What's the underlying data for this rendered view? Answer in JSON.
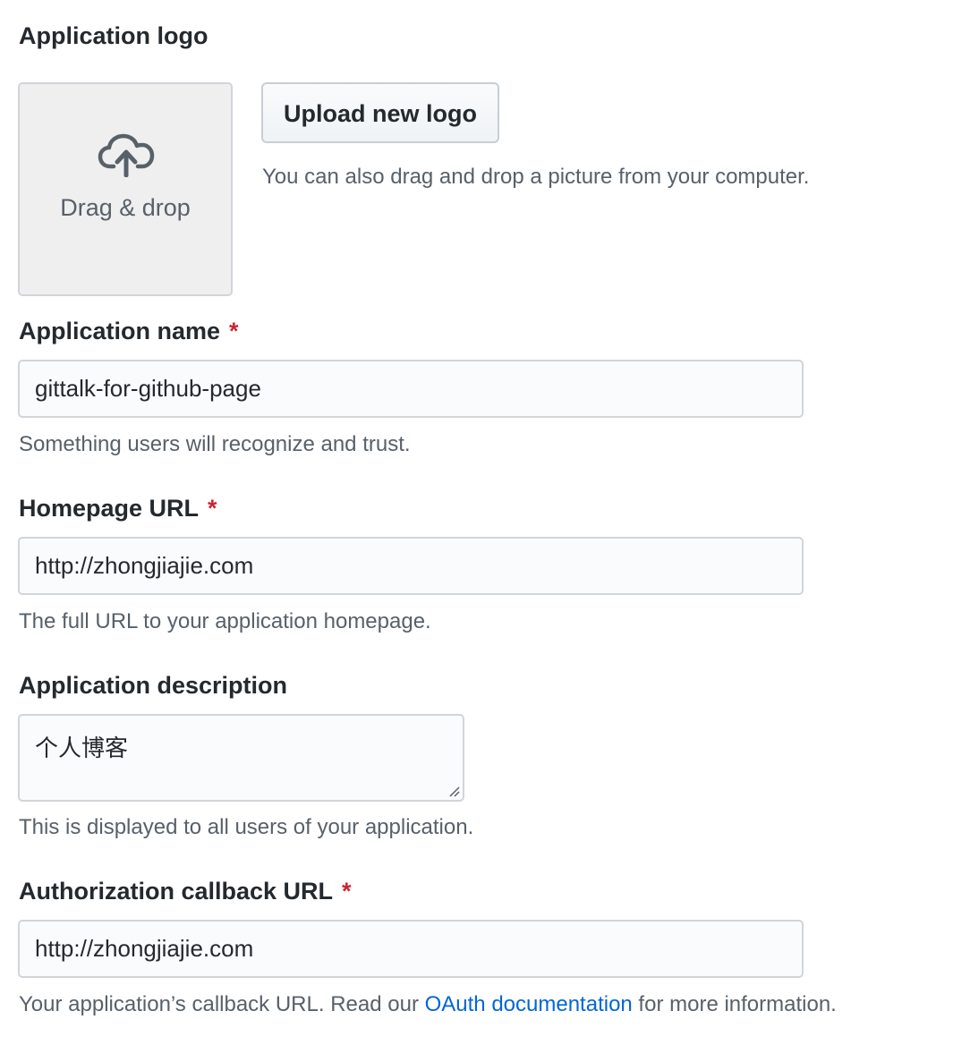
{
  "logo": {
    "label": "Application logo",
    "dropzone_text": "Drag & drop",
    "dropzone_icon": "cloud-upload-icon",
    "upload_button": "Upload new logo",
    "upload_note": "You can also drag and drop a picture from your computer."
  },
  "name": {
    "label": "Application name",
    "required_mark": "*",
    "value": "gittalk-for-github-page",
    "note": "Something users will recognize and trust."
  },
  "homepage": {
    "label": "Homepage URL",
    "required_mark": "*",
    "value": "http://zhongjiajie.com",
    "note": "The full URL to your application homepage."
  },
  "description": {
    "label": "Application description",
    "value": "个人博客",
    "note": "This is displayed to all users of your application."
  },
  "callback": {
    "label": "Authorization callback URL",
    "required_mark": "*",
    "value": "http://zhongjiajie.com",
    "note_prefix": "Your application’s callback URL. Read our ",
    "note_link": "OAuth documentation",
    "note_suffix": " for more information."
  },
  "colors": {
    "required": "#cb2431",
    "link": "#0366d6",
    "muted": "#586069",
    "text": "#24292e"
  }
}
